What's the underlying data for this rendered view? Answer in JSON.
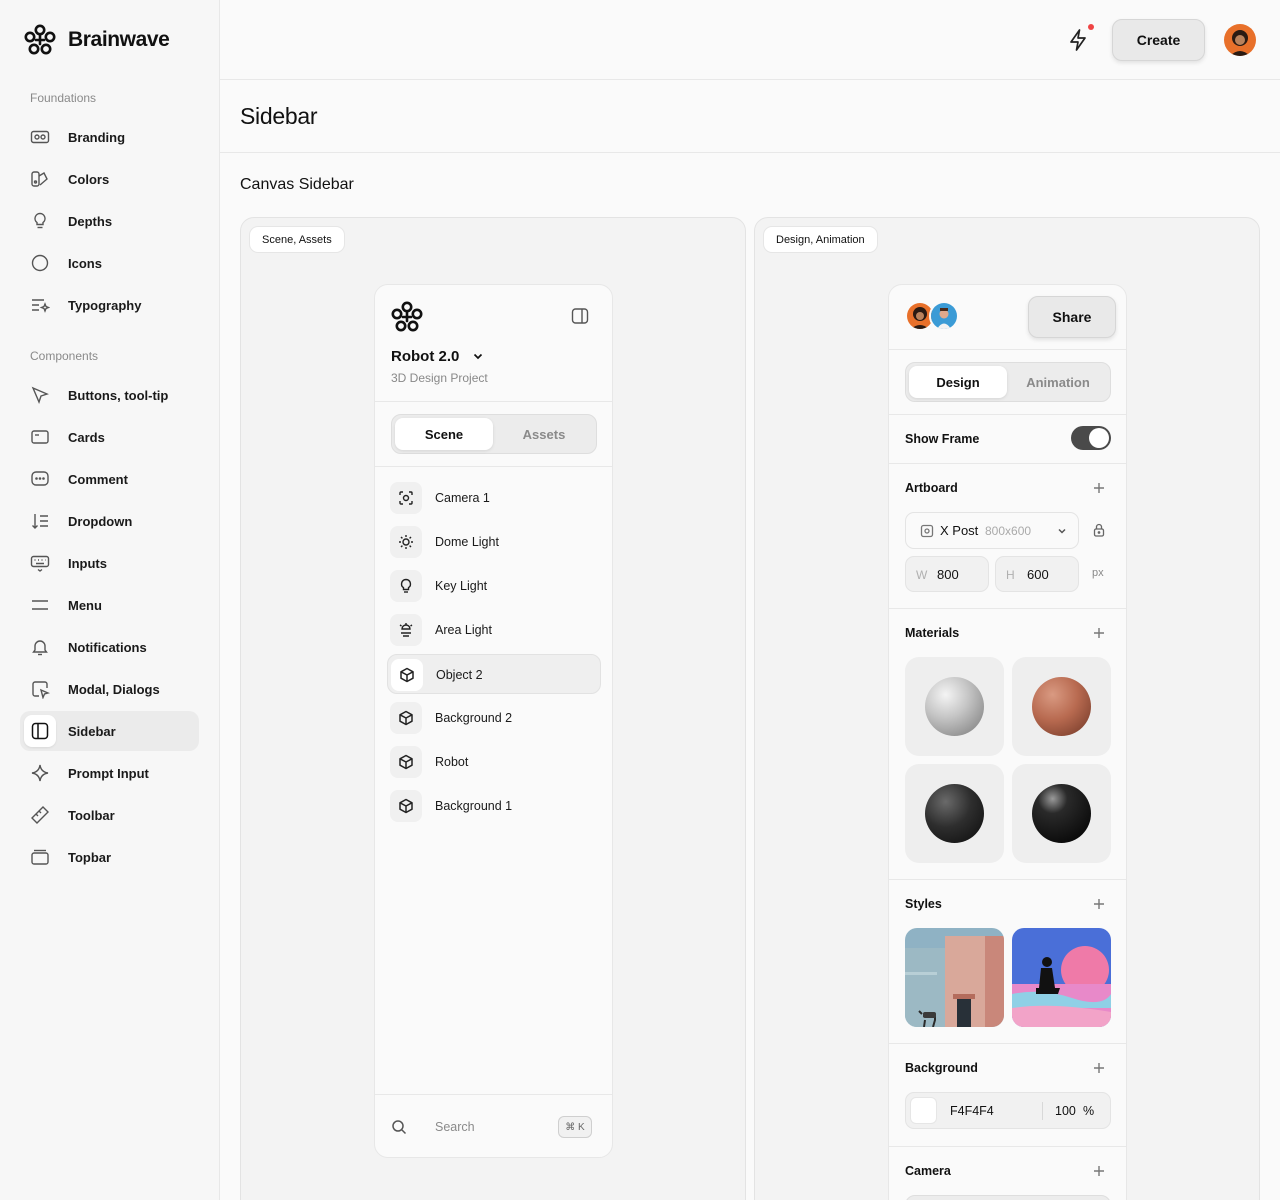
{
  "app": {
    "brand": "Brainwave"
  },
  "nav": {
    "foundations_label": "Foundations",
    "foundations": [
      {
        "label": "Branding",
        "icon": "branding-icon"
      },
      {
        "label": "Colors",
        "icon": "colors-icon"
      },
      {
        "label": "Depths",
        "icon": "depths-icon"
      },
      {
        "label": "Icons",
        "icon": "icons-icon"
      },
      {
        "label": "Typography",
        "icon": "typography-icon"
      }
    ],
    "components_label": "Components",
    "components": [
      {
        "label": "Buttons, tool-tip",
        "icon": "cursor-icon"
      },
      {
        "label": "Cards",
        "icon": "card-icon"
      },
      {
        "label": "Comment",
        "icon": "comment-icon"
      },
      {
        "label": "Dropdown",
        "icon": "dropdown-icon"
      },
      {
        "label": "Inputs",
        "icon": "keyboard-icon"
      },
      {
        "label": "Menu",
        "icon": "menu-icon"
      },
      {
        "label": "Notifications",
        "icon": "bell-icon"
      },
      {
        "label": "Modal, Dialogs",
        "icon": "modal-icon"
      },
      {
        "label": "Sidebar",
        "icon": "sidebar-icon",
        "active": true
      },
      {
        "label": "Prompt Input",
        "icon": "sparkle-icon"
      },
      {
        "label": "Toolbar",
        "icon": "ruler-icon"
      },
      {
        "label": "Topbar",
        "icon": "topbar-icon"
      }
    ]
  },
  "topbar": {
    "create_label": "Create"
  },
  "page": {
    "title": "Sidebar",
    "section_title": "Canvas Sidebar"
  },
  "left_panel": {
    "tag": "Scene, Assets",
    "project_name": "Robot 2.0",
    "project_subtitle": "3D Design Project",
    "tabs": [
      "Scene",
      "Assets"
    ],
    "active_tab": "Scene",
    "items": [
      {
        "label": "Camera 1",
        "icon": "camera-focus-icon"
      },
      {
        "label": "Dome Light",
        "icon": "sun-icon"
      },
      {
        "label": "Key Light",
        "icon": "bulb-icon"
      },
      {
        "label": "Area Light",
        "icon": "area-light-icon"
      },
      {
        "label": "Object 2",
        "icon": "cube-icon",
        "selected": true
      },
      {
        "label": "Background 2",
        "icon": "cube-icon"
      },
      {
        "label": "Robot",
        "icon": "cube-icon"
      },
      {
        "label": "Background 1",
        "icon": "cube-icon"
      }
    ],
    "search_placeholder": "Search",
    "search_shortcut": "⌘ K"
  },
  "right_panel": {
    "tag": "Design, Animation",
    "share_label": "Share",
    "tabs": [
      "Design",
      "Animation"
    ],
    "active_tab": "Design",
    "show_frame_label": "Show Frame",
    "show_frame_on": true,
    "artboard_label": "Artboard",
    "artboard_preset": "X Post",
    "artboard_preset_size": "800x600",
    "width_label": "W",
    "width_value": "800",
    "height_label": "H",
    "height_value": "600",
    "unit": "px",
    "materials_label": "Materials",
    "materials": [
      "silver-matte",
      "copper-matte",
      "black-matte",
      "black-glossy"
    ],
    "styles_label": "Styles",
    "styles": [
      "architecture-with-horse",
      "surreal-laptop-sunset"
    ],
    "background_label": "Background",
    "background_hex": "F4F4F4",
    "background_opacity": "100",
    "background_opacity_unit": "%",
    "camera_label": "Camera"
  },
  "colors": {
    "accent_dot": "#ef4444",
    "toggle_on": "#4a4a4a",
    "swatch": "#F4F4F4"
  }
}
